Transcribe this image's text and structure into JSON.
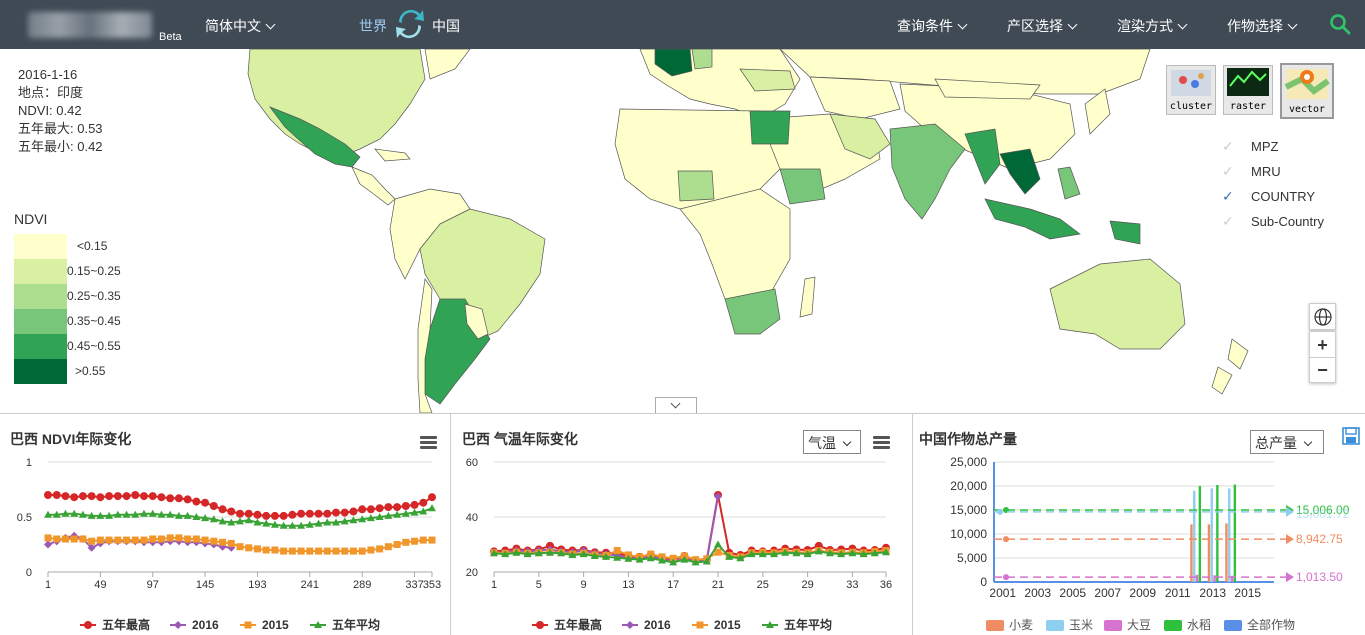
{
  "topbar": {
    "beta": "Beta",
    "language": "简体中文",
    "world": "世界",
    "china": "中国",
    "menus": [
      "查询条件",
      "产区选择",
      "渲染方式",
      "作物选择"
    ]
  },
  "info": {
    "date": "2016-1-16",
    "location": "地点：印度",
    "ndvi": "NDVI: 0.42",
    "max5": "五年最大: 0.53",
    "min5": "五年最小: 0.42"
  },
  "legend": {
    "title": "NDVI",
    "items": [
      {
        "label": "<0.15",
        "color": "#ffffcc"
      },
      {
        "label": "0.15~0.25",
        "color": "#d9f0a3"
      },
      {
        "label": "0.25~0.35",
        "color": "#addd8e"
      },
      {
        "label": "0.35~0.45",
        "color": "#78c679"
      },
      {
        "label": "0.45~0.55",
        "color": "#31a354"
      },
      {
        "label": ">0.55",
        "color": "#006837"
      }
    ]
  },
  "render_modes": [
    "cluster",
    "raster",
    "vector"
  ],
  "layers": [
    {
      "label": "MPZ",
      "checked": false
    },
    {
      "label": "MRU",
      "checked": false
    },
    {
      "label": "COUNTRY",
      "checked": true
    },
    {
      "label": "Sub-Country",
      "checked": false
    }
  ],
  "zoom": {
    "plus": "+",
    "minus": "−"
  },
  "panel1": {
    "title": "巴西 NDVI年际变化",
    "chart_data": {
      "type": "line",
      "x": [
        1,
        9,
        17,
        25,
        33,
        41,
        49,
        57,
        65,
        73,
        81,
        89,
        97,
        105,
        113,
        121,
        129,
        137,
        145,
        153,
        161,
        169,
        177,
        185,
        193,
        201,
        209,
        217,
        225,
        233,
        241,
        249,
        257,
        265,
        273,
        281,
        289,
        297,
        305,
        313,
        321,
        329,
        337,
        345,
        353
      ],
      "xticks": [
        "1",
        "49",
        "97",
        "145",
        "193",
        "241",
        "289",
        "337",
        "353"
      ],
      "yticks": [
        "0",
        "0.5",
        "1"
      ],
      "ylim": [
        0,
        1
      ],
      "series": [
        {
          "name": "五年最高",
          "color": "#d62728",
          "values": [
            0.7,
            0.7,
            0.69,
            0.68,
            0.69,
            0.69,
            0.68,
            0.69,
            0.69,
            0.69,
            0.7,
            0.69,
            0.69,
            0.68,
            0.67,
            0.67,
            0.66,
            0.64,
            0.63,
            0.6,
            0.57,
            0.55,
            0.53,
            0.53,
            0.52,
            0.51,
            0.51,
            0.51,
            0.52,
            0.53,
            0.53,
            0.53,
            0.53,
            0.54,
            0.54,
            0.55,
            0.57,
            0.57,
            0.58,
            0.59,
            0.59,
            0.6,
            0.61,
            0.63,
            0.68
          ]
        },
        {
          "name": "2016",
          "color": "#9b59b6",
          "values": [
            0.25,
            0.28,
            0.31,
            0.33,
            0.3,
            0.22,
            0.26,
            0.28,
            0.28,
            0.28,
            0.28,
            0.27,
            0.27,
            0.27,
            0.28,
            0.28,
            0.27,
            0.27,
            0.26,
            0.25,
            0.23,
            0.22,
            null,
            null,
            null,
            null,
            null,
            null,
            null,
            null,
            null,
            null,
            null,
            null,
            null,
            null,
            null,
            null,
            null,
            null,
            null,
            null,
            null,
            null,
            null
          ]
        },
        {
          "name": "2015",
          "color": "#f0962b",
          "values": [
            0.31,
            0.3,
            0.3,
            0.3,
            0.3,
            0.28,
            0.29,
            0.29,
            0.29,
            0.29,
            0.29,
            0.29,
            0.3,
            0.3,
            0.31,
            0.31,
            0.3,
            0.3,
            0.29,
            0.28,
            0.27,
            0.26,
            0.23,
            0.22,
            0.21,
            0.2,
            0.2,
            0.19,
            0.19,
            0.19,
            0.19,
            0.19,
            0.19,
            0.19,
            0.19,
            0.19,
            0.19,
            0.2,
            0.21,
            0.23,
            0.25,
            0.27,
            0.28,
            0.29,
            0.29
          ]
        },
        {
          "name": "五年平均",
          "color": "#3aa336",
          "values": [
            0.52,
            0.52,
            0.53,
            0.53,
            0.52,
            0.51,
            0.51,
            0.51,
            0.52,
            0.52,
            0.52,
            0.53,
            0.53,
            0.52,
            0.52,
            0.51,
            0.51,
            0.5,
            0.49,
            0.48,
            0.46,
            0.45,
            0.46,
            0.47,
            0.45,
            0.44,
            0.43,
            0.42,
            0.42,
            0.42,
            0.43,
            0.44,
            0.45,
            0.45,
            0.46,
            0.47,
            0.48,
            0.49,
            0.5,
            0.51,
            0.52,
            0.53,
            0.54,
            0.55,
            0.58
          ]
        }
      ]
    }
  },
  "panel2": {
    "title": "巴西 气温年际变化",
    "select": "气温",
    "chart_data": {
      "type": "line",
      "x": [
        1,
        2,
        3,
        4,
        5,
        6,
        7,
        8,
        9,
        10,
        11,
        12,
        13,
        14,
        15,
        16,
        17,
        18,
        19,
        20,
        21,
        22,
        23,
        24,
        25,
        26,
        27,
        28,
        29,
        30,
        31,
        32,
        33,
        34,
        35,
        36
      ],
      "xticks": [
        "1",
        "5",
        "9",
        "13",
        "17",
        "21",
        "25",
        "29",
        "33",
        "36"
      ],
      "yticks": [
        "20",
        "40",
        "60"
      ],
      "ylim": [
        20,
        60
      ],
      "series": [
        {
          "name": "五年最高",
          "color": "#d62728",
          "values": [
            27.5,
            27.8,
            28.5,
            27.8,
            28.2,
            29.5,
            28.2,
            27.8,
            28.0,
            27.2,
            27.0,
            26.8,
            25.8,
            25.5,
            26.2,
            25.2,
            24.5,
            25.8,
            24.2,
            24.5,
            48.0,
            27.0,
            26.2,
            27.8,
            27.5,
            27.8,
            28.5,
            28.2,
            28.0,
            29.5,
            28.0,
            28.2,
            28.5,
            27.8,
            28.0,
            28.8
          ]
        },
        {
          "name": "2016",
          "color": "#9b59b6",
          "values": [
            27.2,
            27.0,
            27.8,
            27.5,
            27.8,
            28.2,
            27.5,
            27.2,
            27.8,
            26.8,
            26.5,
            26.0,
            25.2,
            25.0,
            25.5,
            24.8,
            23.8,
            24.8,
            23.8,
            24.2,
            47.5,
            null,
            null,
            null,
            null,
            null,
            null,
            null,
            null,
            null,
            null,
            null,
            null,
            null,
            null,
            null
          ]
        },
        {
          "name": "2015",
          "color": "#f0962b",
          "values": [
            27.0,
            26.8,
            27.2,
            26.8,
            27.0,
            27.2,
            27.0,
            26.5,
            26.8,
            26.2,
            26.0,
            27.8,
            26.2,
            25.5,
            26.5,
            25.5,
            25.0,
            25.8,
            24.5,
            24.8,
            27.2,
            26.0,
            25.5,
            27.0,
            27.2,
            27.0,
            27.5,
            27.2,
            27.0,
            27.8,
            27.2,
            27.0,
            27.2,
            27.0,
            27.5,
            27.8
          ]
        },
        {
          "name": "五年平均",
          "color": "#3aa336",
          "values": [
            26.8,
            26.5,
            27.0,
            26.5,
            26.8,
            27.0,
            26.8,
            26.2,
            26.5,
            25.8,
            25.5,
            25.2,
            24.8,
            24.5,
            25.0,
            24.2,
            23.5,
            24.5,
            23.5,
            23.8,
            30.0,
            25.5,
            25.0,
            26.5,
            26.5,
            26.5,
            27.0,
            26.8,
            26.5,
            27.5,
            26.8,
            26.5,
            26.8,
            26.5,
            26.8,
            27.2
          ]
        }
      ]
    }
  },
  "panel3": {
    "title": "中国作物总产量",
    "select": "总产量",
    "chart_data": {
      "type": "bar",
      "xticks": [
        "2001",
        "2003",
        "2005",
        "2007",
        "2009",
        "2011",
        "2013",
        "2015"
      ],
      "yticks": [
        "0",
        "5,000",
        "10,000",
        "15,000",
        "20,000",
        "25,000"
      ],
      "ylim": [
        0,
        25000
      ],
      "xlim": [
        2000.5,
        2016.5
      ],
      "legend": [
        {
          "name": "小麦",
          "color": "#f08c61"
        },
        {
          "name": "玉米",
          "color": "#8ecfef"
        },
        {
          "name": "大豆",
          "color": "#d672cf"
        },
        {
          "name": "水稻",
          "color": "#2fc13c"
        },
        {
          "name": "全部作物",
          "color": "#5b8ee6"
        }
      ],
      "bars": [
        {
          "year": 2012,
          "wheat": 12000,
          "corn": 19000,
          "soy": 1500,
          "rice": 20000
        },
        {
          "year": 2013,
          "wheat": 12000,
          "corn": 19500,
          "soy": 1400,
          "rice": 20200
        },
        {
          "year": 2014,
          "wheat": 12200,
          "corn": 19500,
          "soy": 1300,
          "rice": 20300
        }
      ],
      "reference_lines": [
        {
          "label": "15,006.00",
          "value": 15006,
          "color": "#2fc13c"
        },
        {
          "label": "15,001.72",
          "value": 14600,
          "color": "#8ecfef"
        },
        {
          "label": "8,942.75",
          "value": 8942.75,
          "color": "#f08c61"
        },
        {
          "label": "1,013.50",
          "value": 1013.5,
          "color": "#d672cf"
        }
      ]
    }
  }
}
